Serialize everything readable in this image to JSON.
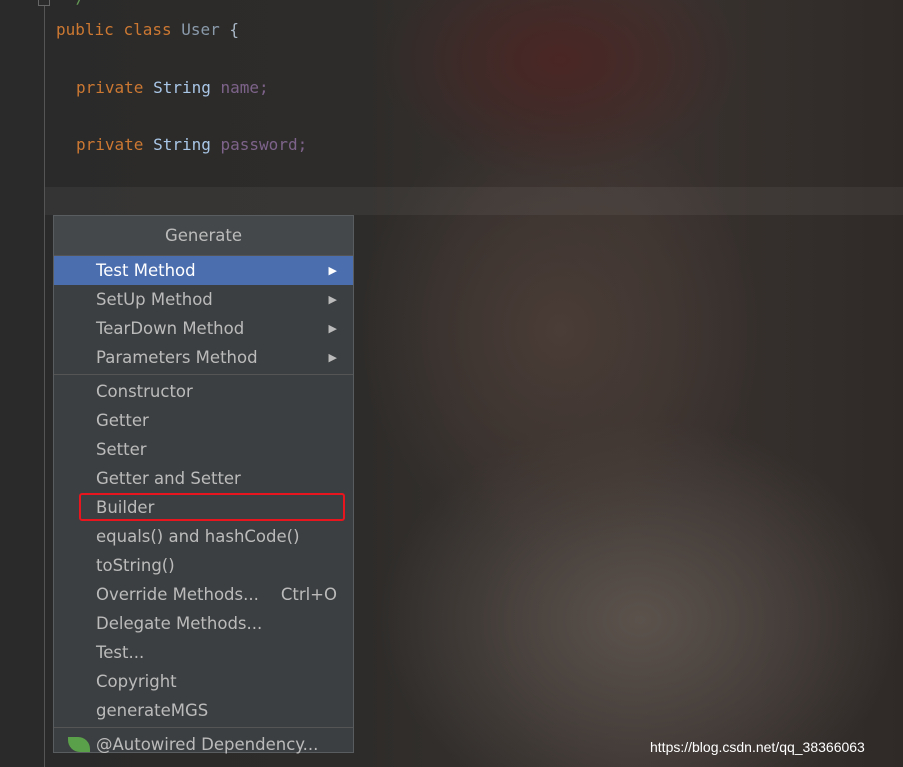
{
  "editor": {
    "comment_tail": "*/",
    "line1": {
      "kw1": "public",
      "kw2": "class",
      "name": "User",
      "brace": "{"
    },
    "line2": {
      "kw": "private",
      "type": "String",
      "field": "name;"
    },
    "line3": {
      "kw": "private",
      "type": "String",
      "field": "password;"
    }
  },
  "menu": {
    "title": "Generate",
    "submenu_items": [
      {
        "label": "Test Method",
        "selected": true
      },
      {
        "label": "SetUp Method"
      },
      {
        "label": "TearDown Method"
      },
      {
        "label": "Parameters Method"
      }
    ],
    "items": [
      {
        "label": "Constructor"
      },
      {
        "label": "Getter"
      },
      {
        "label": "Setter"
      },
      {
        "label": "Getter and Setter"
      },
      {
        "label": "Builder",
        "highlighted": true
      },
      {
        "label": "equals() and hashCode()"
      },
      {
        "label": "toString()"
      },
      {
        "label": "Override Methods...",
        "shortcut": "Ctrl+O"
      },
      {
        "label": "Delegate Methods..."
      },
      {
        "label": "Test..."
      },
      {
        "label": "Copyright"
      },
      {
        "label": "generateMGS"
      }
    ],
    "footer_item": {
      "label": "@Autowired Dependency...",
      "icon": "spring-leaf-icon"
    },
    "highlight_color": "#e8141e",
    "selection_color": "#4b6eaf"
  },
  "watermark": "https://blog.csdn.net/qq_38366063"
}
